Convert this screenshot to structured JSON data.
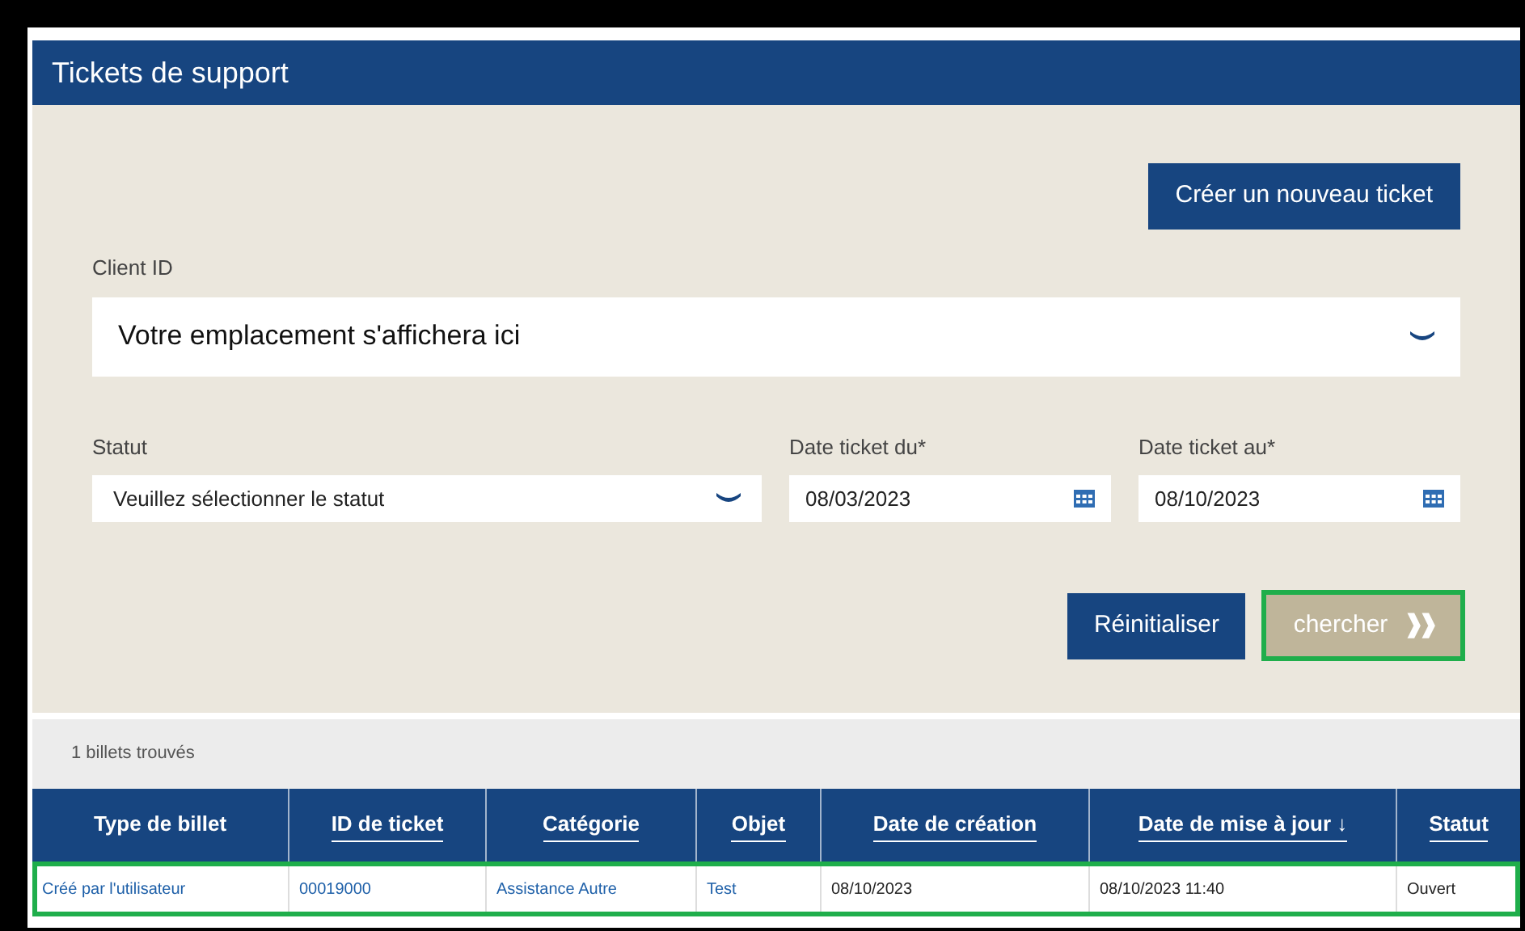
{
  "header": {
    "title": "Tickets de support"
  },
  "new_ticket_button": "Créer un nouveau ticket",
  "client_id": {
    "label": "Client ID",
    "placeholder": "Votre emplacement s'affichera ici"
  },
  "filters": [
    {
      "kind": "select",
      "label": "Statut",
      "placeholder": "Veuillez sélectionner le statut"
    },
    {
      "kind": "date",
      "label": "Date ticket du*",
      "value": "08/03/2023"
    },
    {
      "kind": "date",
      "label": "Date ticket au*",
      "value": "08/10/2023"
    }
  ],
  "buttons": [
    {
      "kind": "primary",
      "label": "Réinitialiser",
      "highlighted": false
    },
    {
      "kind": "search",
      "label": "chercher",
      "icon": "❱❱",
      "highlighted": true
    }
  ],
  "results_count": "1 billets trouvés",
  "table": {
    "columns": [
      {
        "label": "Type de billet",
        "sortable": false
      },
      {
        "label": "ID de ticket",
        "sortable": true
      },
      {
        "label": "Catégorie",
        "sortable": true
      },
      {
        "label": "Objet",
        "sortable": true
      },
      {
        "label": "Date de création",
        "sortable": true
      },
      {
        "label": "Date de mise à jour",
        "sortable": true,
        "sort_indicator": "↓"
      },
      {
        "label": "Statut",
        "sortable": true
      }
    ],
    "rows": [
      {
        "highlighted": true,
        "cells": [
          "Créé par l'utilisateur",
          "00019000",
          "Assistance Autre",
          "Test",
          "08/10/2023",
          "08/10/2023 11:40",
          "Ouvert"
        ]
      }
    ]
  }
}
